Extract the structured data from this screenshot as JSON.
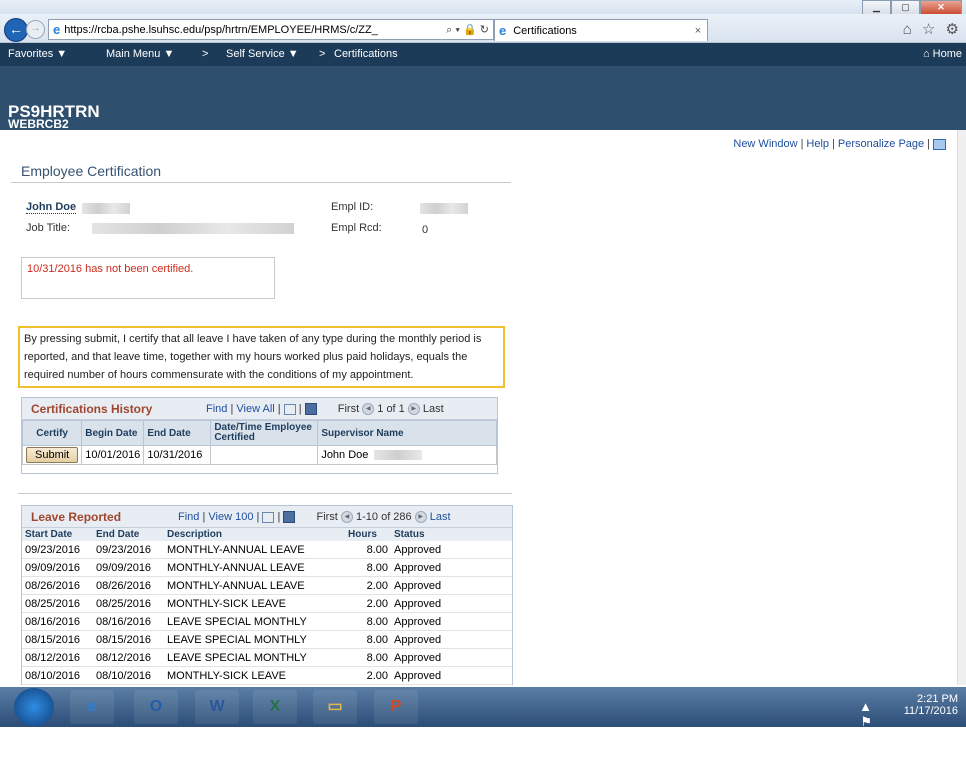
{
  "browser": {
    "url": "https://rcba.pshe.lsuhsc.edu/psp/hrtrn/EMPLOYEE/HRMS/c/ZZ_",
    "url_icons": "⌕ ▾ 🔒 ↻",
    "tab_title": "Certifications",
    "tab_close": "×",
    "win_min": "▁",
    "win_max": "▢",
    "win_close": "✕",
    "tool_icons": "⌂ ☆ ⚙",
    "back": "←",
    "forward": "→",
    "ie_icon": "e"
  },
  "navbar": {
    "favorites": "Favorites ▼",
    "main_menu": "Main Menu ▼",
    "sep": ">",
    "self_service": "Self Service ▼",
    "sep2": ">",
    "certifications": "Certifications",
    "home": "⌂ Home"
  },
  "header": {
    "db": "PS9HRTRN",
    "server": "WEBRCB2"
  },
  "top_links": {
    "new_window": "New Window",
    "help": "Help",
    "personalize": "Personalize Page",
    "sep": "|"
  },
  "page": {
    "title": "Employee Certification",
    "employee_name": "John Doe",
    "job_title_label": "Job Title:",
    "empl_id_label": "Empl ID:",
    "empl_rcd_label": "Empl Rcd:",
    "empl_rcd_value": "0",
    "warning": "10/31/2016 has not been certified.",
    "certification_text": "By pressing submit, I certify that all leave I have taken of any type during the monthly period is reported, and that leave time, together with my hours worked plus paid holidays, equals the required number of hours commensurate with the conditions of my appointment."
  },
  "cert_history": {
    "title": "Certifications History",
    "find": "Find",
    "view_all": "View All",
    "first": "First",
    "range": "1 of 1",
    "last": "Last",
    "prev_icon": "◀",
    "next_icon": "▶",
    "columns": [
      "Certify",
      "Begin Date",
      "End Date",
      "Date/Time Employee Certified",
      "Supervisor Name"
    ],
    "row": {
      "button": "Submit",
      "begin": "10/01/2016",
      "end": "10/31/2016",
      "certified": "",
      "supervisor": "John Doe"
    }
  },
  "leave": {
    "title": "Leave Reported",
    "find": "Find",
    "view_100": "View 100",
    "first": "First",
    "range": "1-10 of 286",
    "last": "Last",
    "prev_icon": "◀",
    "next_icon": "▶",
    "columns": [
      "Start Date",
      "End Date",
      "Description",
      "Hours",
      "Status"
    ],
    "rows": [
      {
        "start": "09/23/2016",
        "end": "09/23/2016",
        "desc": "MONTHLY-ANNUAL LEAVE",
        "hours": "8.00",
        "status": "Approved"
      },
      {
        "start": "09/09/2016",
        "end": "09/09/2016",
        "desc": "MONTHLY-ANNUAL LEAVE",
        "hours": "8.00",
        "status": "Approved"
      },
      {
        "start": "08/26/2016",
        "end": "08/26/2016",
        "desc": "MONTHLY-ANNUAL LEAVE",
        "hours": "2.00",
        "status": "Approved"
      },
      {
        "start": "08/25/2016",
        "end": "08/25/2016",
        "desc": "MONTHLY-SICK LEAVE",
        "hours": "2.00",
        "status": "Approved"
      },
      {
        "start": "08/16/2016",
        "end": "08/16/2016",
        "desc": "LEAVE SPECIAL MONTHLY",
        "hours": "8.00",
        "status": "Approved"
      },
      {
        "start": "08/15/2016",
        "end": "08/15/2016",
        "desc": "LEAVE SPECIAL MONTHLY",
        "hours": "8.00",
        "status": "Approved"
      },
      {
        "start": "08/12/2016",
        "end": "08/12/2016",
        "desc": "LEAVE SPECIAL MONTHLY",
        "hours": "8.00",
        "status": "Approved"
      },
      {
        "start": "08/10/2016",
        "end": "08/10/2016",
        "desc": "MONTHLY-SICK LEAVE",
        "hours": "2.00",
        "status": "Approved"
      }
    ]
  },
  "taskbar": {
    "time": "2:21 PM",
    "date": "11/17/2016",
    "apps": [
      {
        "name": "ie-taskbar-icon",
        "glyph": "e",
        "color": "#2a7fd4"
      },
      {
        "name": "outlook-taskbar-icon",
        "glyph": "O",
        "color": "#1f5ea8"
      },
      {
        "name": "word-taskbar-icon",
        "glyph": "W",
        "color": "#2b579a"
      },
      {
        "name": "excel-taskbar-icon",
        "glyph": "X",
        "color": "#217346"
      },
      {
        "name": "explorer-taskbar-icon",
        "glyph": "▭",
        "color": "#e0b84a"
      },
      {
        "name": "powerpoint-taskbar-icon",
        "glyph": "P",
        "color": "#d24726"
      }
    ],
    "tray_icons": "▲ ⚑ ▣ ▤ ♪"
  }
}
